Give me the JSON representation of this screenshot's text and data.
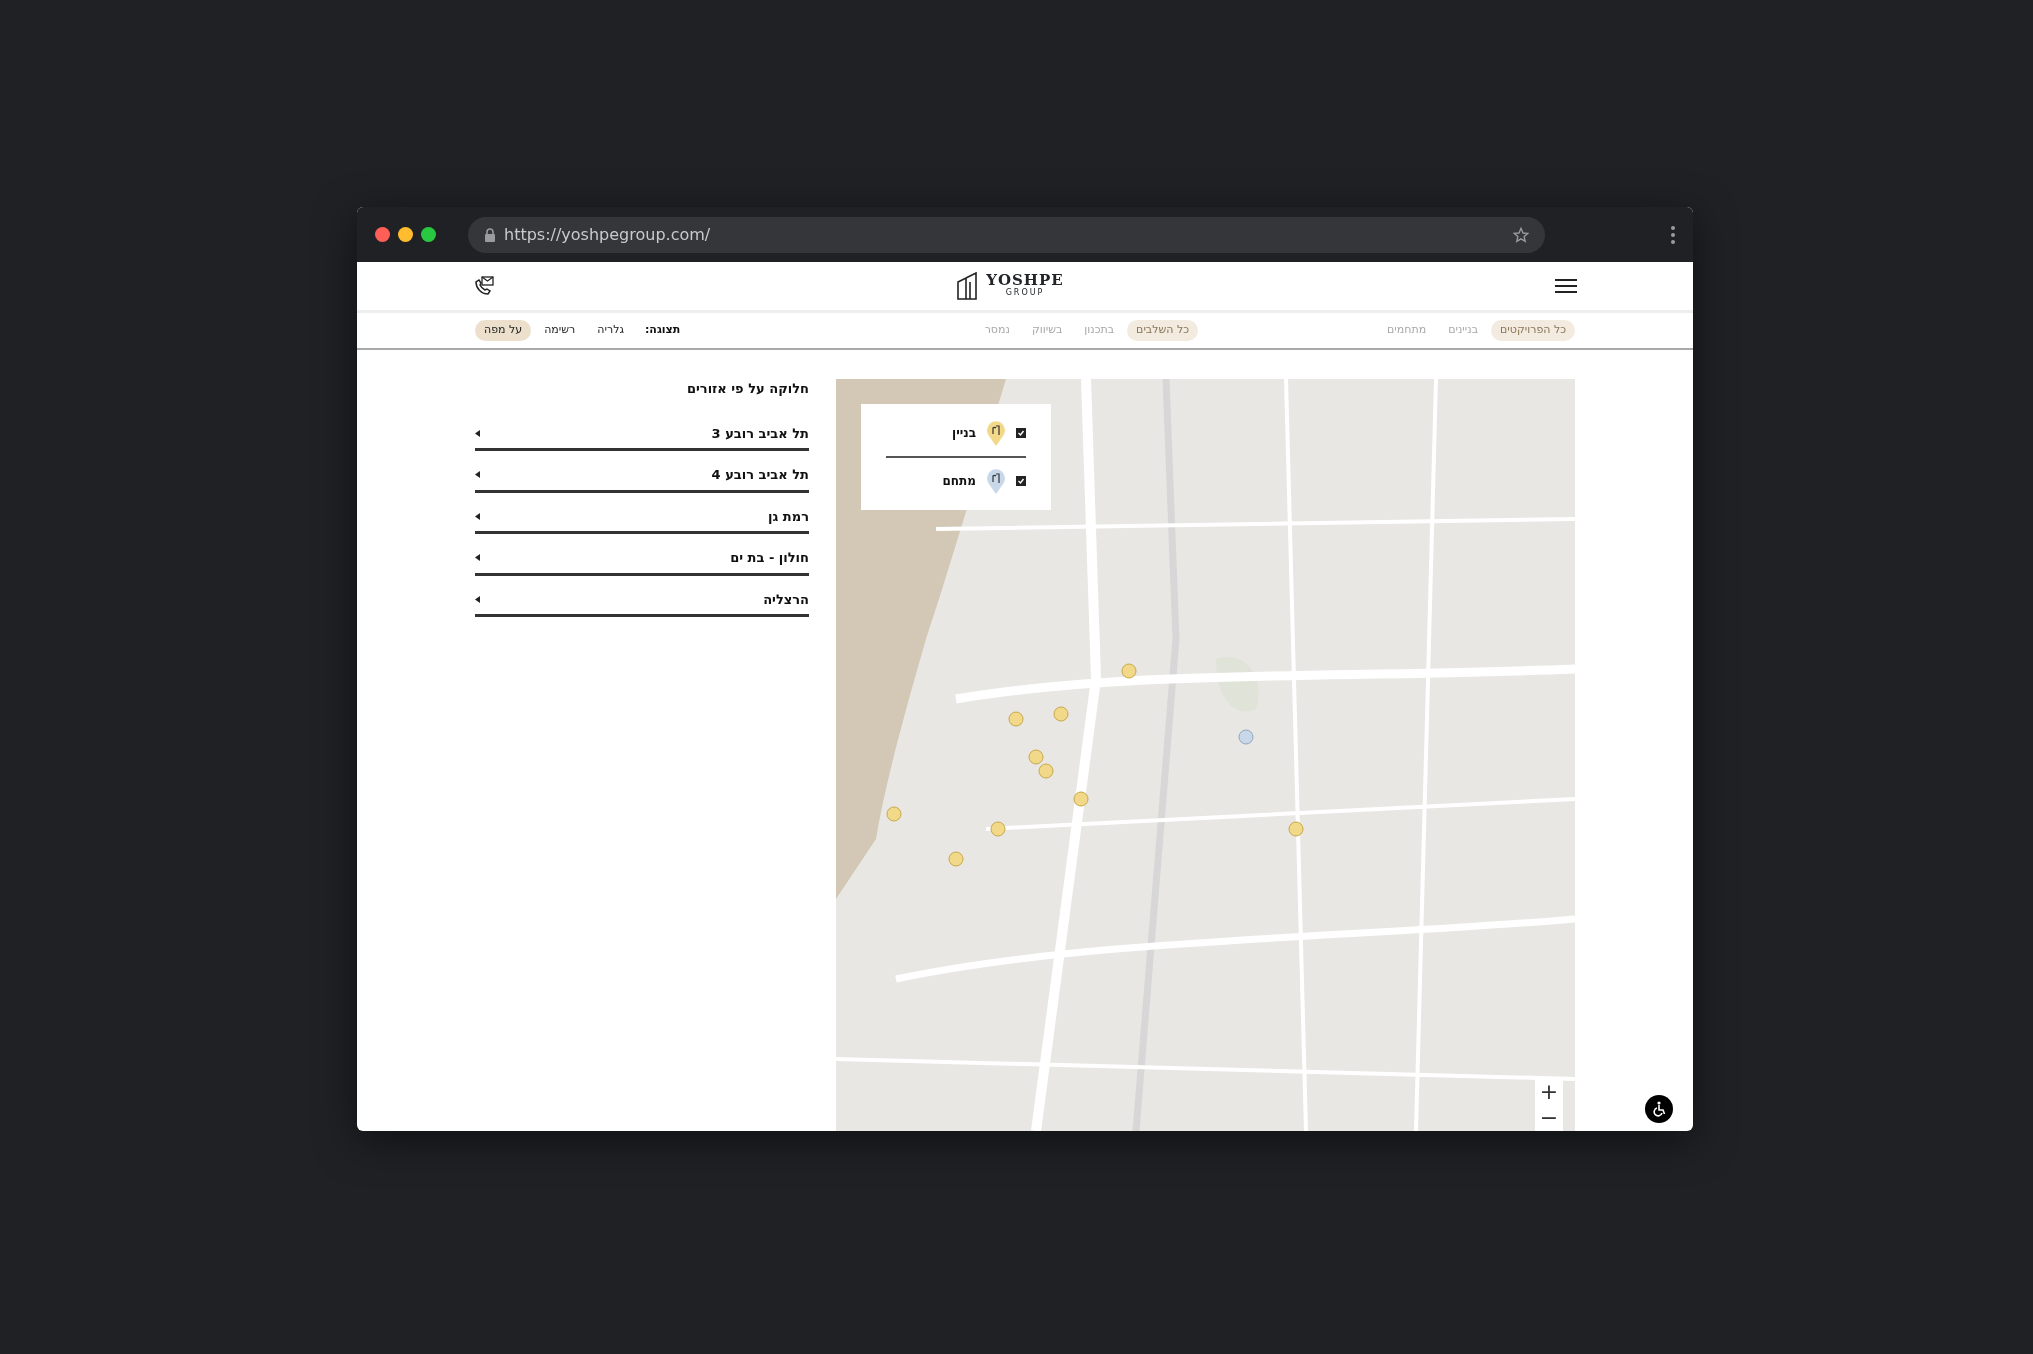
{
  "browser": {
    "url": "https://yoshpegroup.com/"
  },
  "header": {
    "logo_title": "YOSHPE",
    "logo_subtitle": "GROUP"
  },
  "project_types": [
    {
      "label": "כל הפרויקטים",
      "selected": true
    },
    {
      "label": "בניינים",
      "selected": false
    },
    {
      "label": "מתחמים",
      "selected": false
    }
  ],
  "stages": [
    {
      "label": "כל השלבים",
      "selected": true
    },
    {
      "label": "בתכנון",
      "selected": false
    },
    {
      "label": "בשיווק",
      "selected": false
    },
    {
      "label": "נמסר",
      "selected": false
    }
  ],
  "view": {
    "label": "תצוגה:",
    "options": [
      {
        "label": "גלריה",
        "selected": false
      },
      {
        "label": "רשימה",
        "selected": false
      },
      {
        "label": "על מפה",
        "selected": true
      }
    ]
  },
  "regions": {
    "title": "חלוקה על פי אזורים",
    "items": [
      {
        "label": "תל אביב רובע 3"
      },
      {
        "label": "תל אביב רובע 4"
      },
      {
        "label": "רמת גן"
      },
      {
        "label": "חולון - בת ים"
      },
      {
        "label": "הרצליה"
      }
    ]
  },
  "legend": [
    {
      "label": "בניין",
      "checked": true,
      "color": "#f2d98a"
    },
    {
      "label": "מתחם",
      "checked": true,
      "color": "#c8d8e8"
    }
  ],
  "map": {
    "zoom_in": "+",
    "zoom_out": "−"
  }
}
